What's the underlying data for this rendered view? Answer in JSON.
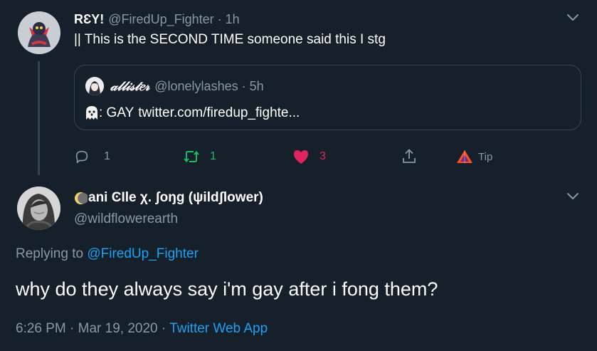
{
  "parent_tweet": {
    "display_name": "RƐY!",
    "handle": "@FiredUp_Fighter",
    "dot": "·",
    "time": "1h",
    "text": "|| This is the SECOND TIME someone said this I stg",
    "quote": {
      "display_name": "𝒶𝓁𝓁𝒾𝓈𝓉𝑒𝓇",
      "handle": "@lonelylashes",
      "dot": "·",
      "time": "5h",
      "text_prefix": ": GAY",
      "link": "twitter.com/firedup_fighte..."
    },
    "actions": {
      "reply_count": "1",
      "retweet_count": "1",
      "like_count": "3",
      "tip_label": "Tip"
    }
  },
  "main_tweet": {
    "display_name": "ani ϾIle χ. ʃoŋg (ψildʃlower)",
    "handle": "@wildflowerearth",
    "replying_prefix": "Replying to",
    "replying_to": "@FiredUp_Fighter",
    "text": "why do they always say i'm gay after i fong them?",
    "time": "6:26 PM",
    "dot1": "·",
    "date": "Mar 19, 2020",
    "dot2": "·",
    "source": "Twitter Web App"
  },
  "colors": {
    "background": "#15202b",
    "muted": "#8899a6",
    "link": "#1da1f2",
    "retweet": "#17bf63",
    "like": "#e0245e",
    "border": "#38444d"
  },
  "icons": {
    "reply": "reply-icon",
    "retweet": "retweet-icon",
    "like": "heart-icon",
    "share": "share-icon",
    "tip": "tip-icon",
    "menu": "chevron-down-icon"
  }
}
